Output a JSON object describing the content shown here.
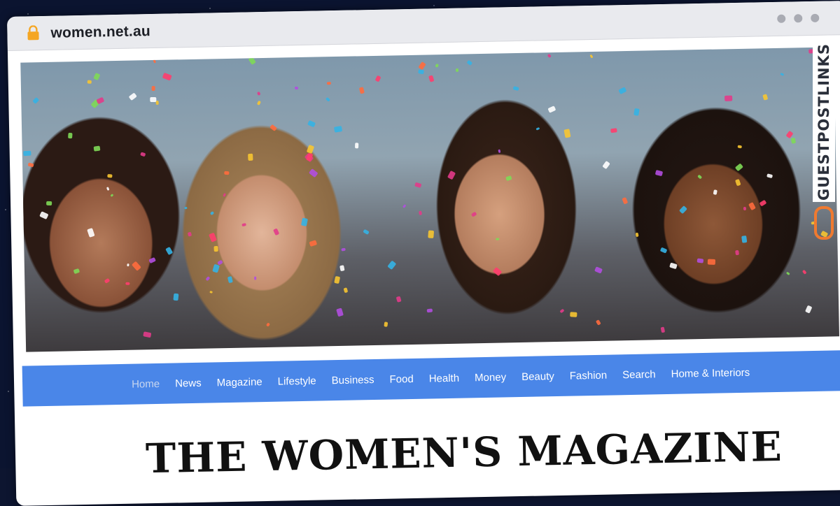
{
  "browser": {
    "url": "women.net.au"
  },
  "watermark": {
    "text": "GUESTPOSTLINKS"
  },
  "hero": {
    "image_description_icon": "hero-photo"
  },
  "nav": {
    "items": [
      {
        "label": "Home",
        "active": true
      },
      {
        "label": "News"
      },
      {
        "label": "Magazine"
      },
      {
        "label": "Lifestyle"
      },
      {
        "label": "Business"
      },
      {
        "label": "Food"
      },
      {
        "label": "Health"
      },
      {
        "label": "Money"
      },
      {
        "label": "Beauty"
      },
      {
        "label": "Fashion"
      },
      {
        "label": "Search"
      },
      {
        "label": "Home & Interiors"
      }
    ]
  },
  "page": {
    "title": "THE WOMEN'S MAGAZINE"
  },
  "colors": {
    "nav_bg": "#4a86e8",
    "lock": "#f5a623",
    "watermark_accent": "#f07a30"
  }
}
